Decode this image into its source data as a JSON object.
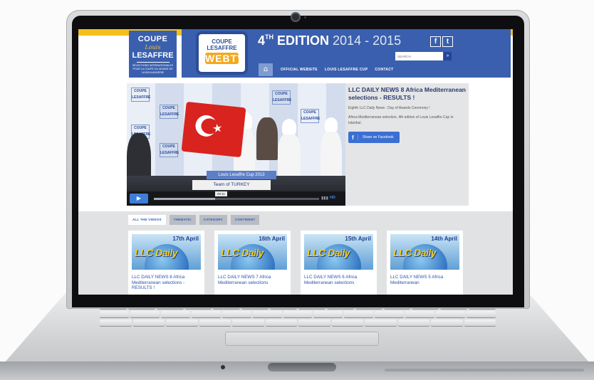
{
  "site": {
    "logo": {
      "line1": "COUPE",
      "script": "Louis",
      "line2": "LESAFFRE",
      "subtitle": "SÉLECTIONS INTERNATIONALES POUR LA COUPE DU MONDE DE LA BOULANGERIE"
    },
    "badge": {
      "line1": "COUPE",
      "line2": "LESAFFRE",
      "main": "WEBTV"
    },
    "edition": {
      "prefix": "4",
      "sup": "TH",
      "label": " EDITION ",
      "years": "2014 - 2015"
    },
    "social": {
      "facebook": "f",
      "twitter": "t"
    },
    "search": {
      "placeholder": "SEARCH",
      "button": "»"
    },
    "nav": {
      "home_icon": "⌂",
      "items": [
        "OFFICIAL WEBSITE",
        "LOUIS LESAFFRE CUP",
        "CONTACT"
      ]
    }
  },
  "video": {
    "banner_text": "COUPE LESAFFRE",
    "lower_third_event": "Louis Lesaffre Cup 2013",
    "lower_third_team": "Team of TURKEY",
    "time": "00:11",
    "progress": 0.37,
    "play_icon": "▶",
    "bars_icon": "▮▮▮",
    "hd": "HD"
  },
  "featured": {
    "title": "LLC DAILY NEWS 8 Africa Mediterranean selections - RESULTS !",
    "line1": "Eighth LLC Daily News : Day of Awards Ceremony !",
    "line2": "Africa Mediterranean selection, 4th edition of Louis Lesaffre Cup in Istanbul.",
    "share_label": "Share on Facebook",
    "share_icon": "f"
  },
  "tabs": [
    "ALL THE VIDEOS",
    "THEMATIC",
    "CATEGORY",
    "CONTINENT"
  ],
  "cards": [
    {
      "date": "17th April",
      "logo": "LLC Daily",
      "title": "LLC DAILY NEWS 8 Africa Mediterranean selections - RESULTS !"
    },
    {
      "date": "16th April",
      "logo": "LLC Daily",
      "title": "LLC DAILY NEWS 7 Africa Mediterranean selections"
    },
    {
      "date": "15th April",
      "logo": "LLC Daily",
      "title": "LLC DAILY NEWS 6 Africa Mediterranean selections"
    },
    {
      "date": "14th April",
      "logo": "LLC Daily",
      "title": "LLC DAILY NEWS 5 Africa Mediterranean"
    }
  ],
  "colors": {
    "brand_blue": "#3a5fae",
    "accent_yellow": "#f4c01a",
    "button_blue": "#3b6fd2"
  }
}
